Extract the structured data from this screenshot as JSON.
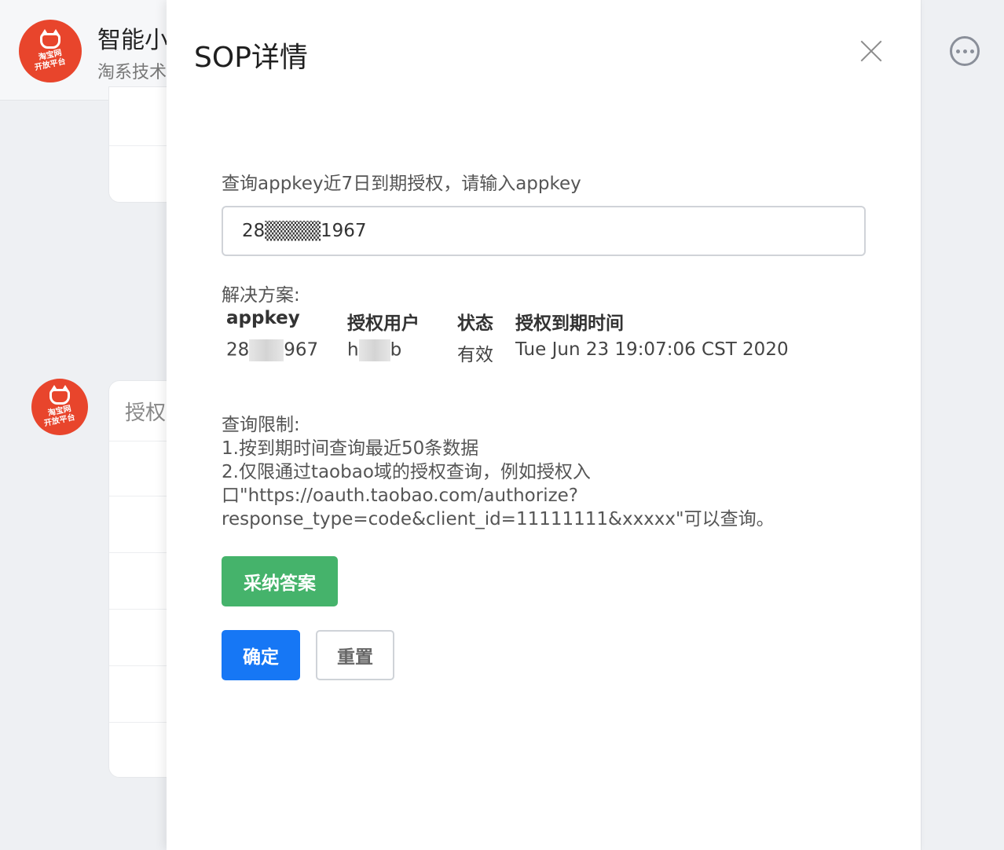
{
  "background": {
    "app_title": "智能小",
    "app_subtitle": "淘系技术",
    "logo_text_line1": "淘宝网",
    "logo_text_line2": "开放平台",
    "card_text": "授权"
  },
  "drawer": {
    "title": "SOP详情",
    "query_label": "查询appkey近7日到期授权，请输入appkey",
    "query_input_value": "28▒▒▒▒1967",
    "solution_label": "解决方案:",
    "table": {
      "headers": [
        "appkey",
        "授权用户",
        "状态",
        "授权到期时间"
      ],
      "row": {
        "appkey_prefix": "28",
        "appkey_suffix": "967",
        "user_prefix": "h",
        "user_suffix": "b",
        "status": "有效",
        "expiry": "Tue Jun 23 19:07:06 CST 2020"
      }
    },
    "limits": {
      "title": "查询限制:",
      "line1": "1.按到期时间查询最近50条数据",
      "line2": "2.仅限通过taobao域的授权查询，例如授权入",
      "line3": "口\"https://oauth.taobao.com/authorize?",
      "line4": "response_type=code&client_id=11111111&xxxxx\"可以查询。"
    },
    "buttons": {
      "adopt": "采纳答案",
      "confirm": "确定",
      "reset": "重置"
    }
  },
  "colors": {
    "primary": "#1677f5",
    "success": "#45b36b",
    "logo": "#e8452c"
  }
}
